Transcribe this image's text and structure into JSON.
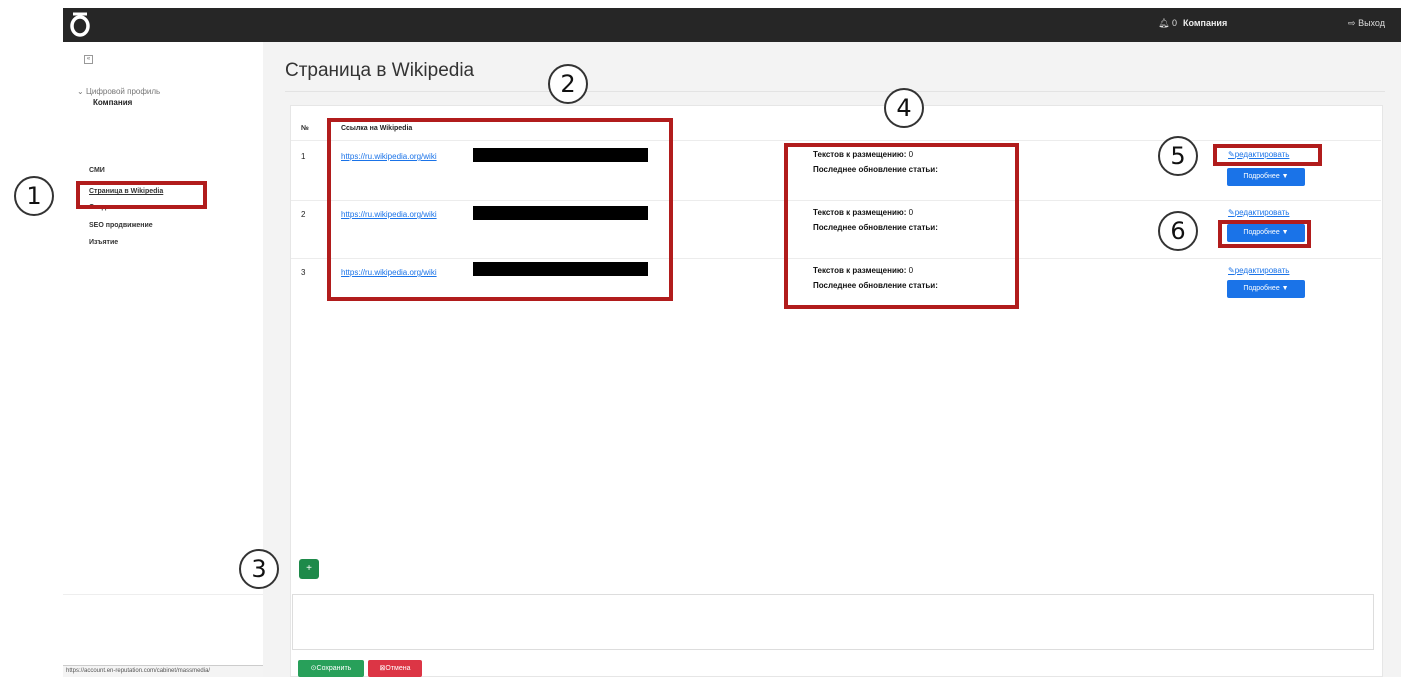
{
  "topbar": {
    "notifications": "0",
    "company": "Компания",
    "logout": "Выход"
  },
  "sidebar": {
    "profile_label": "Цифровой профиль",
    "company": "Компания",
    "items": [
      {
        "label": "СМИ"
      },
      {
        "label": "Страница в Wikipedia"
      },
      {
        "label": "Создание контента"
      },
      {
        "label": "SEO продвижение"
      },
      {
        "label": "Изъятие"
      }
    ]
  },
  "main": {
    "title": "Страница в Wikipedia",
    "table": {
      "col_num": "№",
      "col_link": "Ссылка на Wikipedia",
      "stat_texts_label": "Текстов к размещению:",
      "stat_update_label": "Последнее обновление статьи:",
      "edit_label": "редактировать",
      "more_label": "Подробнее ▼",
      "rows": [
        {
          "num": "1",
          "link": "https://ru.wikipedia.org/wiki",
          "texts": "0"
        },
        {
          "num": "2",
          "link": "https://ru.wikipedia.org/wiki",
          "texts": "0"
        },
        {
          "num": "3",
          "link": "https://ru.wikipedia.org/wiki",
          "texts": "0"
        }
      ]
    },
    "add_label": "+",
    "save_label": "Сохранить",
    "cancel_label": "Отмена"
  },
  "statusbar": "https://account.en-reputation.com/cabinet/massmedia/",
  "annotations": [
    "1",
    "2",
    "3",
    "4",
    "5",
    "6"
  ]
}
